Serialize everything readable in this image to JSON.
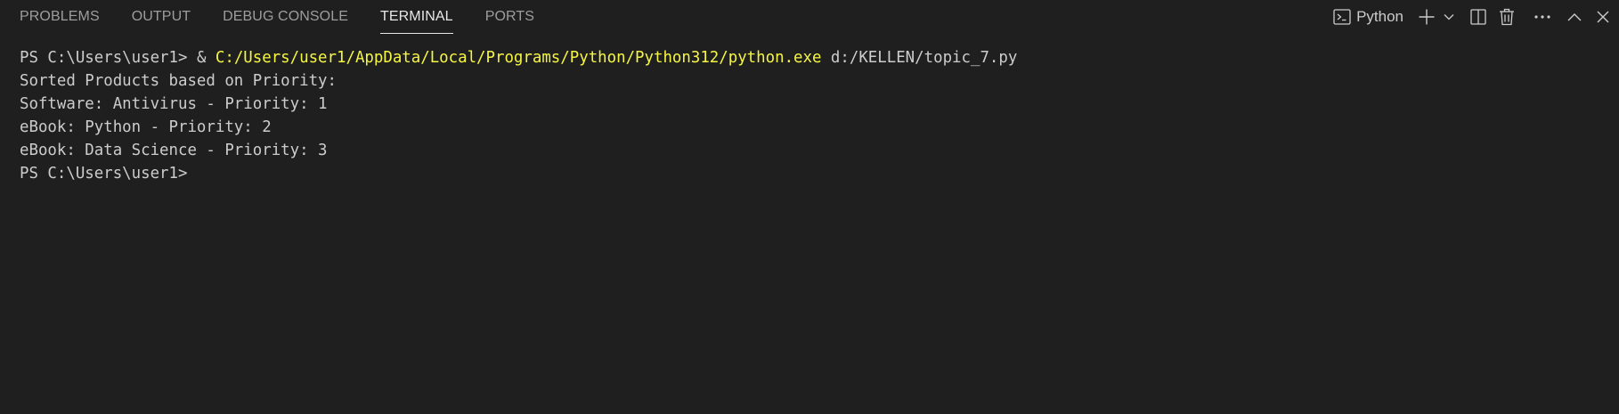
{
  "tabs": [
    {
      "label": "PROBLEMS",
      "active": false
    },
    {
      "label": "OUTPUT",
      "active": false
    },
    {
      "label": "DEBUG CONSOLE",
      "active": false
    },
    {
      "label": "TERMINAL",
      "active": true
    },
    {
      "label": "PORTS",
      "active": false
    }
  ],
  "actions": {
    "terminal_name": "Python",
    "icons": [
      "terminal-icon",
      "plus-icon",
      "chevron-down-icon",
      "split-icon",
      "trash-icon",
      "more-icon",
      "chevron-up-icon",
      "close-icon"
    ]
  },
  "terminal": {
    "prompt": "PS C:\\Users\\user1> ",
    "command_amp": "& ",
    "command_exe": "C:/Users/user1/AppData/Local/Programs/Python/Python312/python.exe",
    "command_arg": " d:/KELLEN/topic_7.py",
    "output": [
      "Sorted Products based on Priority:",
      "Software: Antivirus - Priority: 1",
      "eBook: Python - Priority: 2",
      "eBook: Data Science - Priority: 3"
    ],
    "final_prompt": "PS C:\\Users\\user1>"
  },
  "colors": {
    "background": "#1f1f1f",
    "text": "#cccccc",
    "exe_highlight": "#f5f543",
    "tab_inactive": "#9d9d9d",
    "tab_active": "#e7e7e7"
  }
}
